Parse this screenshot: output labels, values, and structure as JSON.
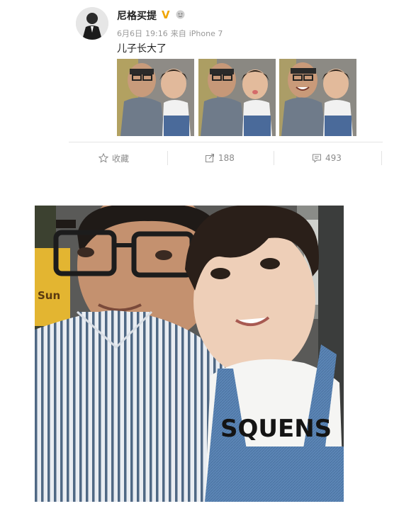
{
  "post": {
    "username": "尼格买提",
    "verified_mark": "V",
    "date": "6月6日",
    "time": "19:16",
    "source_prefix": "来自",
    "source": "iPhone 7",
    "text": "儿子长大了",
    "thumbnail_count": 3,
    "actions": {
      "favorite_label": "收藏",
      "repost_count": "188",
      "comment_count": "493"
    },
    "colors": {
      "verified": "#f0a500",
      "meta_text": "#999999",
      "action_text": "#8b8b8b"
    },
    "icons": [
      "star-icon",
      "repost-icon",
      "comment-icon",
      "level-icon"
    ]
  },
  "photo": {
    "shirt_text": "SQUENS",
    "sign_text": "Sun"
  }
}
